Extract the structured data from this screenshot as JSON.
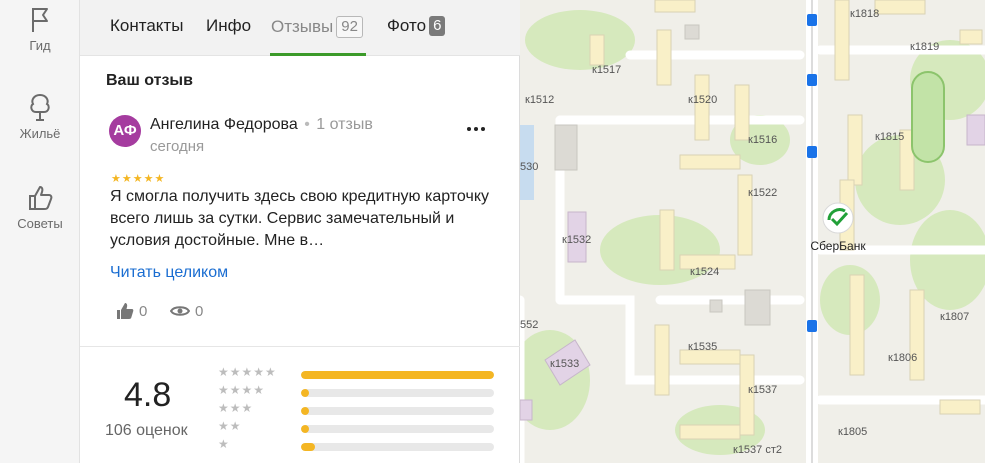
{
  "sidebar": {
    "items": [
      {
        "label": "Гид",
        "icon": "flag-icon"
      },
      {
        "label": "Жильё",
        "icon": "tree-icon"
      },
      {
        "label": "Советы",
        "icon": "thumbs-up-icon"
      }
    ]
  },
  "tabs": [
    {
      "label": "Контакты"
    },
    {
      "label": "Инфо"
    },
    {
      "label": "Отзывы",
      "count": "92",
      "active": true
    },
    {
      "label": "Фото",
      "count": "6"
    }
  ],
  "review": {
    "section_title": "Ваш отзыв",
    "avatar_initials": "АФ",
    "author": "Ангелина Федорова",
    "author_reviews": "1 отзыв",
    "date": "сегодня",
    "stars": "★★★★★",
    "text": "Я смогла получить здесь свою кредитную карточку всего лишь за сутки. Сервис замечательный и условия достойные. Мне в…",
    "read_more": "Читать целиком",
    "likes": "0",
    "views": "0"
  },
  "rating": {
    "value": "4.8",
    "label": "106 оценок",
    "distribution": [
      {
        "stars": "★★★★★",
        "share": 1.0
      },
      {
        "stars": "★★★★",
        "share": 0.02
      },
      {
        "stars": "★★★",
        "share": 0.04
      },
      {
        "stars": "★★",
        "share": 0.02
      },
      {
        "stars": "★",
        "share": 0.07
      }
    ]
  },
  "map": {
    "bank_name": "СберБанк",
    "buildings": [
      "к1818",
      "к1819",
      "к1517",
      "к1512",
      "к1520",
      "к1516",
      "к1815",
      "530",
      "к1522",
      "к1532",
      "к1524",
      "к1807",
      "552",
      "к1535",
      "к1533",
      "к1806",
      "к1537",
      "к1805",
      "к1537 ст2"
    ]
  },
  "colors": {
    "accent_green": "#3b9a29",
    "star_yellow": "#f4b623",
    "link_blue": "#1a6dd1",
    "avatar_purple": "#a53c9f"
  }
}
